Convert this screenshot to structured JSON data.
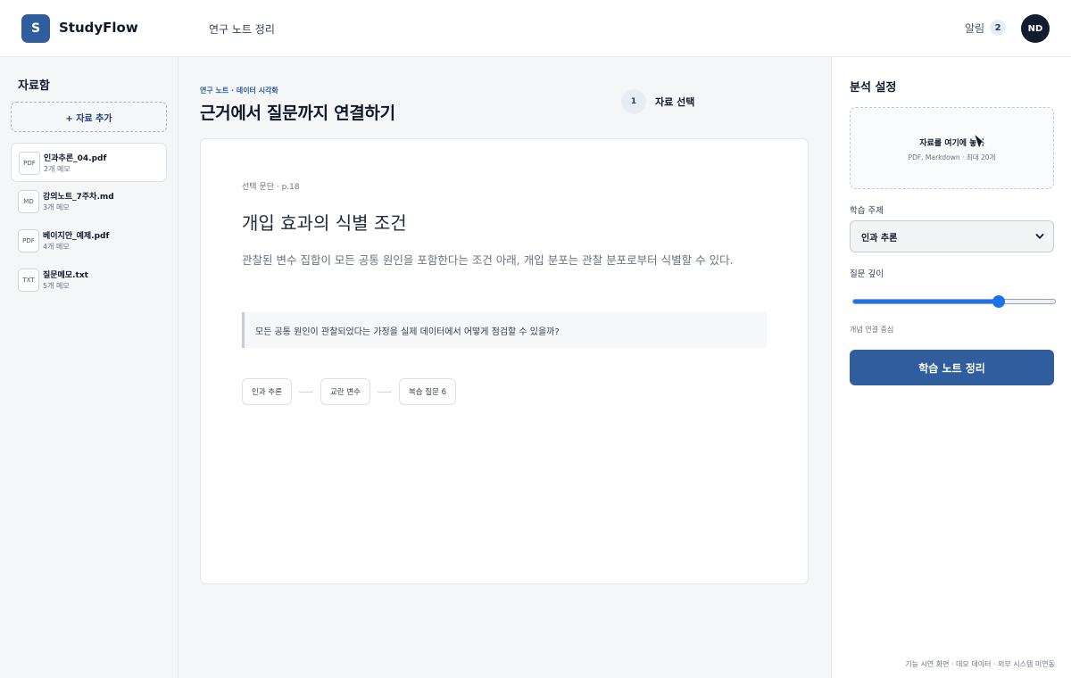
{
  "header": {
    "logo_letter": "S",
    "brand": "StudyFlow",
    "nav_link": "연구 노트 정리",
    "notifications_label": "알림",
    "notifications_count": "2",
    "avatar_initials": "ND"
  },
  "sidebar": {
    "title": "자료함",
    "add_button": "+ 자료 추가",
    "files": [
      {
        "type": "PDF",
        "name": "인과추론_04.pdf",
        "meta": "2개 메모",
        "selected": true
      },
      {
        "type": "MD",
        "name": "강의노트_7주차.md",
        "meta": "3개 메모",
        "selected": false
      },
      {
        "type": "PDF",
        "name": "베이지안_예제.pdf",
        "meta": "4개 메모",
        "selected": false
      },
      {
        "type": "TXT",
        "name": "질문메모.txt",
        "meta": "5개 메모",
        "selected": false
      }
    ]
  },
  "main": {
    "kicker": "연구 노트 · 데이터 시각화",
    "title": "근거에서 질문까지 연결하기",
    "step_number": "1",
    "step_label": "자료 선택",
    "card": {
      "meta": "선택 문단 · p.18",
      "heading": "개입 효과의 식별 조건",
      "body": "관찰된 변수 집합이 모든 공통 원인을 포함한다는 조건 아래, 개입 분포는 관찰 분포로부터 식별할 수 있다.",
      "quote": "모든 공통 원인이 관찰되었다는 가정을 실제 데이터에서 어떻게 점검할 수 있을까?",
      "chips": [
        "인과 추론",
        "교란 변수",
        "복습 질문 6"
      ]
    }
  },
  "panel": {
    "title": "분석 설정",
    "dropzone_title": "자료를 여기에 놓기",
    "dropzone_sub": "PDF, Markdown · 최대 20개",
    "topic_label": "학습 주제",
    "topic_value": "인과 추론",
    "depth_label": "질문 깊이",
    "depth_value": 0.72,
    "depth_caption": "개념 연결 중심",
    "primary_button": "학습 노트 정리"
  },
  "footer_note": "기능 시연 화면 · 데모 데이터 · 외부 시스템 미연동",
  "colors": {
    "brand": "#2f5d9e",
    "slider_accent": "#1a73e8"
  }
}
